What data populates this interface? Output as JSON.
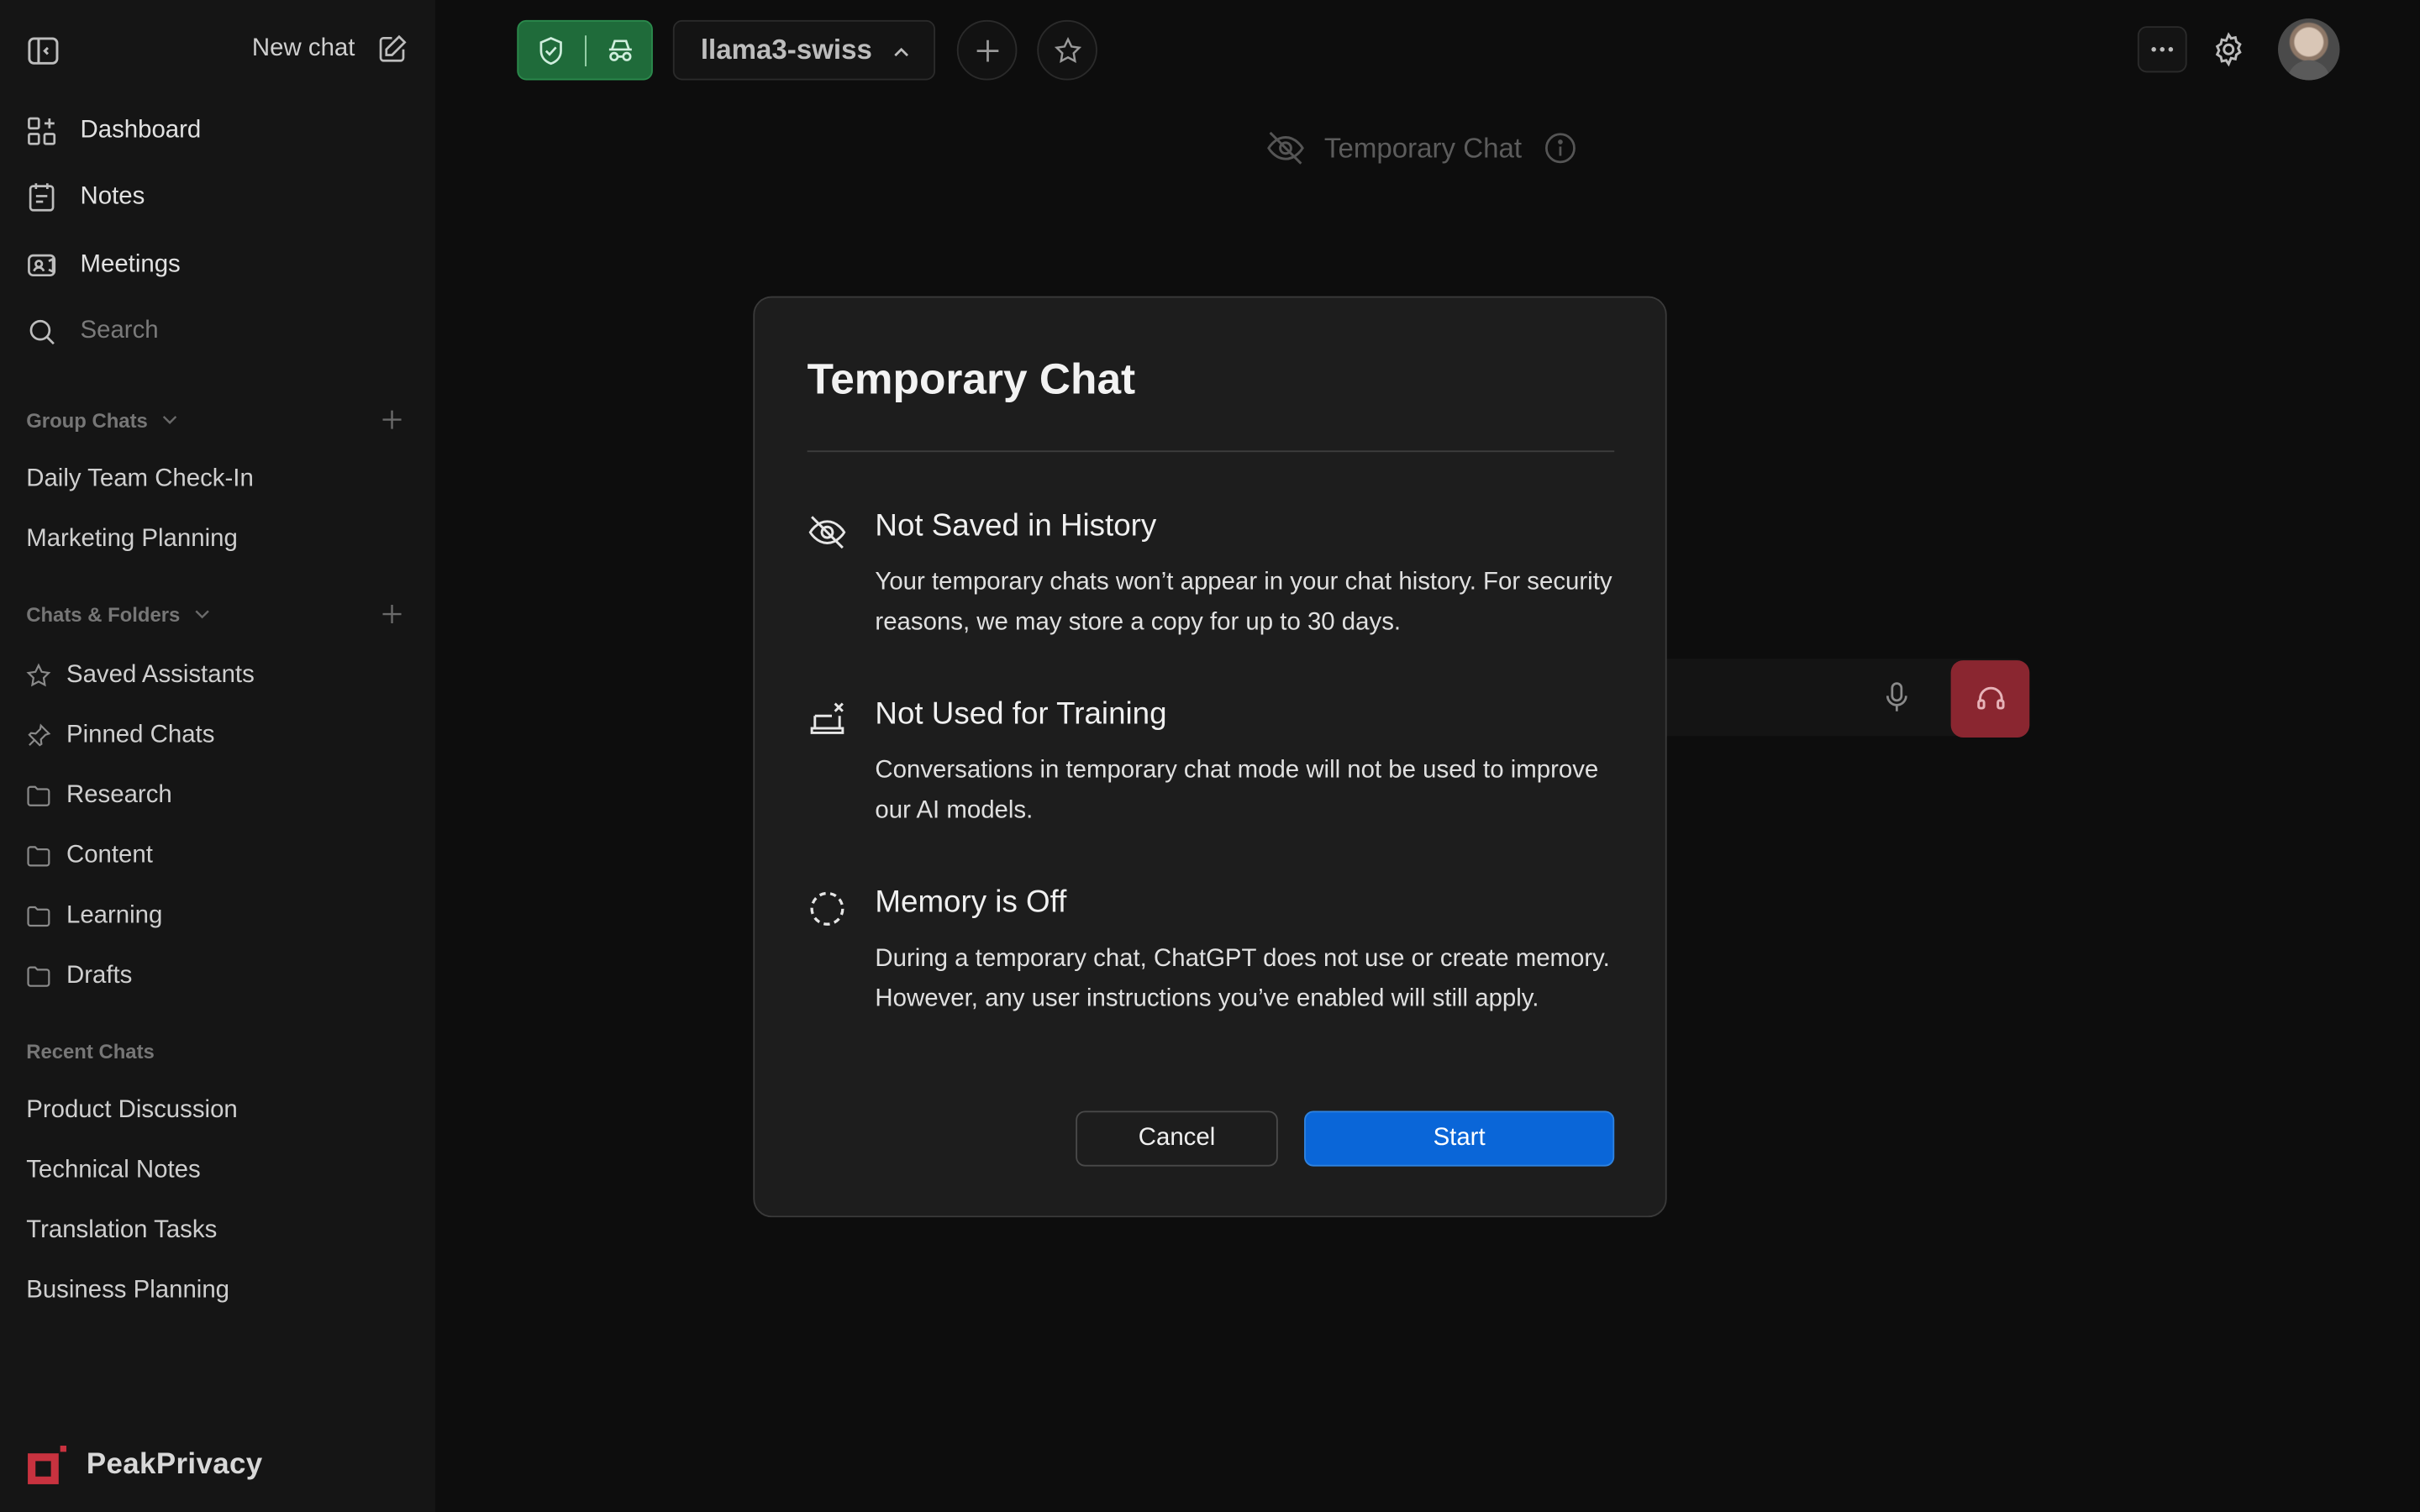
{
  "sidebar": {
    "new_chat_label": "New chat",
    "nav": [
      {
        "label": "Dashboard",
        "icon": "dashboard-icon"
      },
      {
        "label": "Notes",
        "icon": "notes-icon"
      },
      {
        "label": "Meetings",
        "icon": "meetings-icon"
      },
      {
        "label": "Search",
        "icon": "search-icon"
      }
    ],
    "group_chats": {
      "header": "Group Chats",
      "items": [
        "Daily Team Check-In",
        "Marketing Planning"
      ]
    },
    "chats_folders": {
      "header": "Chats & Folders",
      "items": [
        {
          "label": "Saved Assistants",
          "icon": "star-icon"
        },
        {
          "label": "Pinned Chats",
          "icon": "pin-icon"
        },
        {
          "label": "Research",
          "icon": "folder-icon"
        },
        {
          "label": "Content",
          "icon": "folder-icon"
        },
        {
          "label": "Learning",
          "icon": "folder-icon"
        },
        {
          "label": "Drafts",
          "icon": "folder-icon"
        }
      ]
    },
    "recent_chats": {
      "header": "Recent Chats",
      "items": [
        "Product Discussion",
        "Technical Notes",
        "Translation Tasks",
        "Business Planning"
      ]
    },
    "brand_name": "PeakPrivacy"
  },
  "header": {
    "model_name": "llama3-swiss",
    "temporary_chat_label": "Temporary Chat"
  },
  "modal": {
    "title": "Temporary Chat",
    "features": [
      {
        "icon": "eye-off-icon",
        "title": "Not Saved in History",
        "description": "Your temporary chats won’t appear in your chat history. For security reasons, we may store a copy for up to 30 days."
      },
      {
        "icon": "no-training-icon",
        "title": "Not Used for Training",
        "description": "Conversations in temporary chat mode will not be used to improve our AI models."
      },
      {
        "icon": "memory-off-icon",
        "title": "Memory is Off",
        "description": "During a temporary chat, ChatGPT does not use or create memory. However, any user instructions you’ve enabled will still apply."
      }
    ],
    "cancel_label": "Cancel",
    "start_label": "Start"
  },
  "colors": {
    "background": "#0d0d0d",
    "sidebar": "#151515",
    "modal": "#1d1d1d",
    "accent_blue": "#0a66d8",
    "privacy_green": "#1f6b3a",
    "call_red": "#8a2630"
  }
}
